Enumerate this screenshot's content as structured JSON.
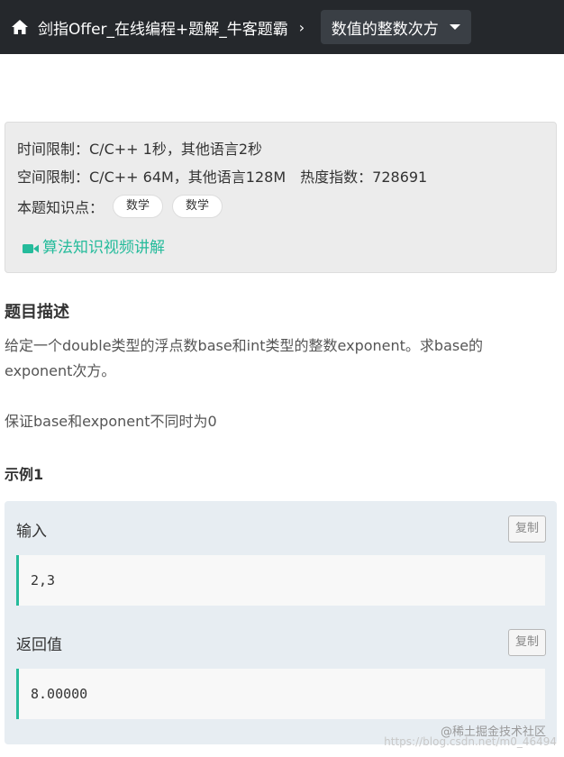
{
  "header": {
    "breadcrumb": "剑指Offer_在线编程+题解_牛客题霸",
    "separator": "›",
    "problem_title": "数值的整数次方"
  },
  "info": {
    "time_limit": "时间限制：C/C++ 1秒，其他语言2秒",
    "space_limit": "空间限制：C/C++ 64M，其他语言128M",
    "heat_index": "热度指数：728691",
    "knowledge_label": "本题知识点：",
    "tags": [
      "数学",
      "数学"
    ],
    "video_link": "算法知识视频讲解"
  },
  "description": {
    "heading": "题目描述",
    "paragraph1": "给定一个double类型的浮点数base和int类型的整数exponent。求base的exponent次方。",
    "paragraph2": "保证base和exponent不同时为0"
  },
  "example": {
    "heading": "示例1",
    "input_label": "输入",
    "input_value": "2,3",
    "output_label": "返回值",
    "output_value": "8.00000",
    "copy_label": "复制"
  },
  "watermark": {
    "line1": "@稀土掘金技术社区",
    "line2": "https://blog.csdn.net/m0_46494"
  },
  "colors": {
    "topbar": "#25282c",
    "accent": "#25bb9b",
    "info_bg": "#ececec",
    "example_bg": "#e7edf2"
  },
  "icons": {
    "home": "home-icon",
    "video": "video-camera-icon",
    "caret": "caret-down-icon"
  }
}
